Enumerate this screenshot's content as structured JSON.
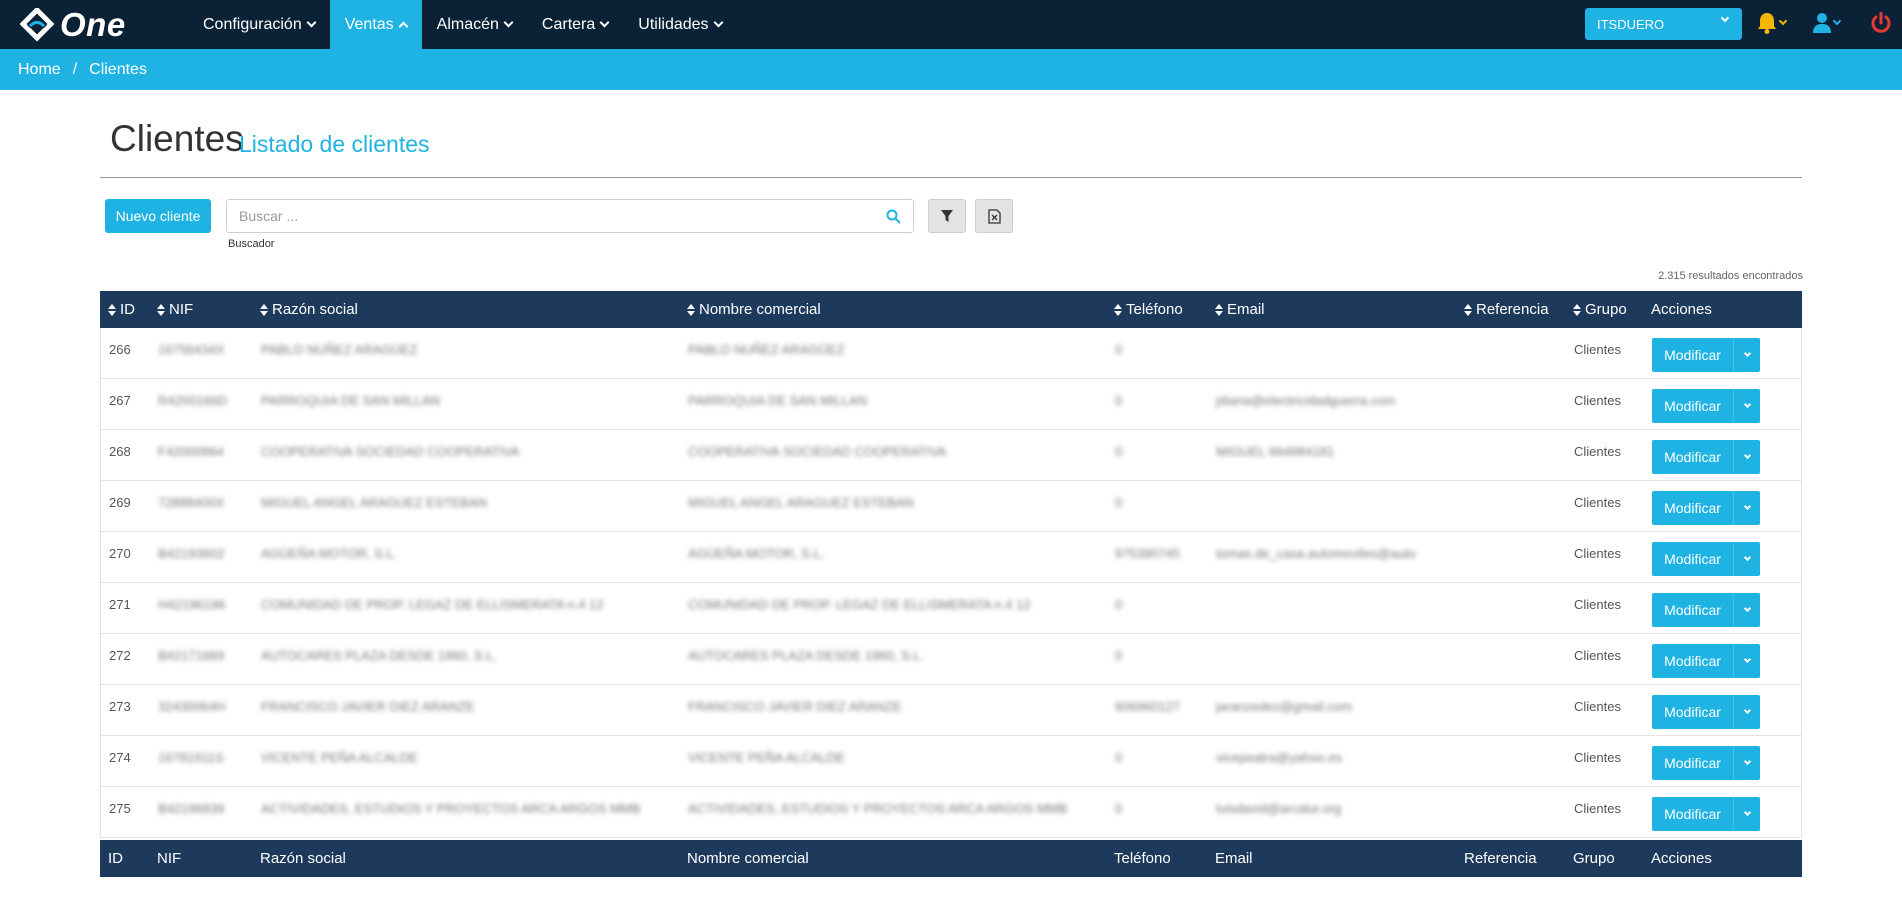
{
  "nav": {
    "brand": "One",
    "items": [
      {
        "label": "Configuración",
        "active": false
      },
      {
        "label": "Ventas",
        "active": true
      },
      {
        "label": "Almacén",
        "active": false
      },
      {
        "label": "Cartera",
        "active": false
      },
      {
        "label": "Utilidades",
        "active": false
      }
    ],
    "company": "ITSDUERO"
  },
  "breadcrumb": {
    "home": "Home",
    "separator": "/",
    "current": "Clientes"
  },
  "page": {
    "title": "Clientes",
    "subtitle": "Listado de clientes"
  },
  "toolbar": {
    "new_label": "Nuevo cliente",
    "search_placeholder": "Buscar ...",
    "search_help": "Buscador",
    "results": "2.315 resultados encontrados"
  },
  "table": {
    "columns": [
      "ID",
      "NIF",
      "Razón social",
      "Nombre comercial",
      "Teléfono",
      "Email",
      "Referencia",
      "Grupo",
      "Acciones"
    ],
    "action_label": "Modificar",
    "rows": [
      {
        "id": "266",
        "nif": "16756434X",
        "razon": "PABLO NUÑEZ ARAGÜEZ",
        "nombre": "PABLO NUÑEZ ARAGÜEZ",
        "tel": "0",
        "email": "",
        "grupo": "Clientes"
      },
      {
        "id": "267",
        "nif": "R4200166D",
        "razon": "PARROQUIA DE SAN MILLAN",
        "nombre": "PARROQUIA DE SAN MILLAN",
        "tel": "0",
        "email": "jdiana@electricidadguerra.com",
        "grupo": "Clientes"
      },
      {
        "id": "268",
        "nif": "F42000864",
        "razon": "COOPERATIVA SOCIEDAD COOPERATIVA",
        "nombre": "COOPERATIVA SOCIEDAD COOPERATIVA",
        "tel": "0",
        "email": "MIGUEL 664884181",
        "grupo": "Clientes"
      },
      {
        "id": "269",
        "nif": "72888400X",
        "razon": "MIGUEL ANGEL ARAGUEZ ESTEBAN",
        "nombre": "MIGUEL ANGEL ARAGUEZ ESTEBAN",
        "tel": "0",
        "email": "",
        "grupo": "Clientes"
      },
      {
        "id": "270",
        "nif": "B42193602",
        "razon": "AGÜEÑA MOTOR, S.L.",
        "nombre": "AGÜEÑA MOTOR, S.L.",
        "tel": "975390745",
        "email": "tomas.de_casa.automoviles@auto",
        "grupo": "Clientes"
      },
      {
        "id": "271",
        "nif": "H42196196",
        "razon": "COMUNIDAD DE PROP. LEGAZ DE ELLISMERATA n.4 12",
        "nombre": "COMUNIDAD DE PROP. LEGAZ DE ELLISMERATA n.4 12",
        "tel": "0",
        "email": "",
        "grupo": "Clientes"
      },
      {
        "id": "272",
        "nif": "B42171669",
        "razon": "AUTOCARES PLAZA DESDE 1960, S.L.",
        "nombre": "AUTOCARES PLAZA DESDE 1960, S.L.",
        "tel": "0",
        "email": "",
        "grupo": "Clientes"
      },
      {
        "id": "273",
        "nif": "32430064H",
        "razon": "FRANCISCO JAVIER DIEZ ARANZE",
        "nombre": "FRANCISCO JAVIER DIEZ ARANZE",
        "tel": "606960127",
        "email": "jaranzedez@gmail.com",
        "grupo": "Clientes"
      },
      {
        "id": "274",
        "nif": "16781911S",
        "razon": "VICENTE PEÑA ALCALDE",
        "nombre": "VICENTE PEÑA ALCALDE",
        "tel": "0",
        "email": "vicepeatra@yahoo.es",
        "grupo": "Clientes"
      },
      {
        "id": "275",
        "nif": "B42196839",
        "razon": "ACTIVIDADES, ESTUDIOS Y PROYECTOS ARCA ARGOS MMB",
        "nombre": "ACTIVIDADES, ESTUDIOS Y PROYECTOS ARCA ARGOS MMB",
        "tel": "0",
        "email": "luisdavid@arcalur.org",
        "grupo": "Clientes"
      }
    ]
  },
  "colors": {
    "navy": "#0b2236",
    "accent": "#1fb3e3",
    "table_header": "#1d3a5c",
    "bell": "#f5b800",
    "power": "#e53935"
  }
}
